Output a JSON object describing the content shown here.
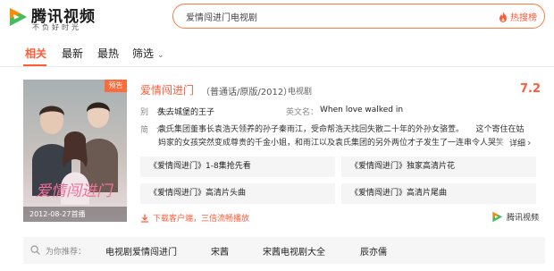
{
  "brand": {
    "name": "腾讯视频",
    "slogan": "不负好时光",
    "logo_icon": "tencent-video-logo"
  },
  "search": {
    "value": "爱情闯进门电视剧",
    "hot_label": "热搜榜",
    "hot_icon": "fire-icon"
  },
  "tabs": [
    {
      "label": "相关",
      "active": true
    },
    {
      "label": "最新",
      "active": false
    },
    {
      "label": "最热",
      "active": false
    },
    {
      "label": "筛选",
      "active": false
    }
  ],
  "filter_chevron": "chevron-down-icon",
  "result": {
    "badge": "预告",
    "poster_date": "2012-08-27首播",
    "poster_title_art": "爱情闯进门",
    "title": "爱情闯进门",
    "subtitle": "（普通话/原版/2012）",
    "type": "电视剧",
    "score": "7.2",
    "alias_label": "别　名：",
    "alias_value": "失去城堡的王子",
    "english_label": "英文名：",
    "english_value": "When love walked in",
    "desc_label": "简　介：",
    "desc_line1": "袁氏集团董事长袁浩天领养的孙子秦雨江，受命帮浩天找回失散二十年的外孙女骆萱。　　这个寄住在姑",
    "desc_line2": "妈家的女孩突然变成尊贵的千金小姐，和雨江以及袁氏集团的另外两位才子发生了一连串令人哭笑",
    "more_label": "详细",
    "videos": [
      "《爱情闯进门》1-8集抢先看",
      "《爱情闯进门》独家高清片花",
      "《爱情闯进门》高清片头曲",
      "《爱情闯进门》高清片尾曲"
    ],
    "download_label": "下载客户端，三倍流畅播放",
    "source_label": "腾讯视频"
  },
  "recommend": {
    "label": "为你推荐：",
    "items": [
      "电视剧爱情闯进门",
      "宋茜",
      "宋茜电视剧大全",
      "辰亦儒"
    ]
  },
  "colors": {
    "accent": "#ff5c38",
    "search_border": "#ff7a3c"
  }
}
